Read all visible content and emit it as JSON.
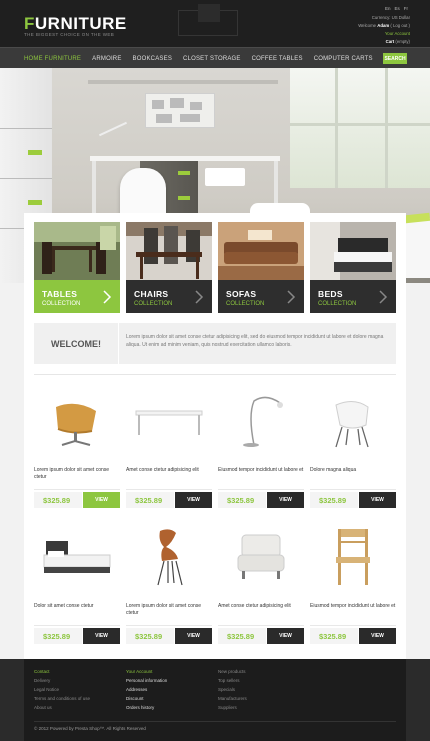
{
  "header": {
    "logo_first": "F",
    "logo_rest": "URNITURE",
    "tagline": "THE BIGGEST CHOICE ON THE WEB",
    "languages": [
      "En",
      "Es",
      "Fr"
    ],
    "currency_label": "Currency:",
    "currency_value": "US Dollar",
    "welcome_label": "Welcome",
    "user": "Adam",
    "logout": "( Log out )",
    "account": "Your Account",
    "cart_label": "Cart",
    "cart_value": "(empty)"
  },
  "nav": {
    "items": [
      "Home Furniture",
      "Armoire",
      "Bookcases",
      "Closet Storage",
      "Coffee Tables",
      "Computer Carts"
    ],
    "search": "SEARCH"
  },
  "colors": {
    "accent": "#8dc63f",
    "dark": "#2a2a2a"
  },
  "categories": [
    {
      "title": "TABLES",
      "subtitle": "COLLECTION"
    },
    {
      "title": "CHAIRS",
      "subtitle": "COLLECTION"
    },
    {
      "title": "SOFAS",
      "subtitle": "COLLECTION"
    },
    {
      "title": "BEDS",
      "subtitle": "COLLECTION"
    }
  ],
  "welcome": {
    "title": "WELCOME!",
    "text": "Lorem ipsum dolor sit amet conse ctetur adipisicing elit, sed do eiusmod tempor incididunt ut labore et dolore magna aliqua. Ut enim ad minim veniam, quis nostrud exercitation ullamco laboris."
  },
  "products": [
    {
      "name": "Lorem ipsum dolor sit amet conse ctetur",
      "price": "$325.89",
      "button": "VIEW"
    },
    {
      "name": "Amet conse ctetur adipisicing elit",
      "price": "$325.89",
      "button": "VIEW"
    },
    {
      "name": "Eiusmod tempor incididunt ut labore et",
      "price": "$325.89",
      "button": "VIEW"
    },
    {
      "name": "Dolore magna aliqua",
      "price": "$325.89",
      "button": "VIEW"
    },
    {
      "name": "Dolor sit amet conse ctetur",
      "price": "$325.89",
      "button": "VIEW"
    },
    {
      "name": "Lorem ipsum dolor sit amet conse ctetur",
      "price": "$325.89",
      "button": "VIEW"
    },
    {
      "name": "Amet conse ctetur adipisicing elit",
      "price": "$325.89",
      "button": "VIEW"
    },
    {
      "name": "Eiusmod tempor incididunt ut labore et",
      "price": "$325.89",
      "button": "VIEW"
    }
  ],
  "footer": {
    "col1": [
      "Contact",
      "Delivery",
      "Legal Notice",
      "Terms and conditions of use",
      "About us"
    ],
    "col2": [
      "Your Account",
      "Personal information",
      "Addresses",
      "Discount",
      "Orders history"
    ],
    "col3": [
      "New products",
      "Top sellers",
      "Specials",
      "Manufacturers",
      "Suppliers"
    ],
    "copyright": "© 2012 Powered by Presta Shop™. All Rights Reserved"
  }
}
